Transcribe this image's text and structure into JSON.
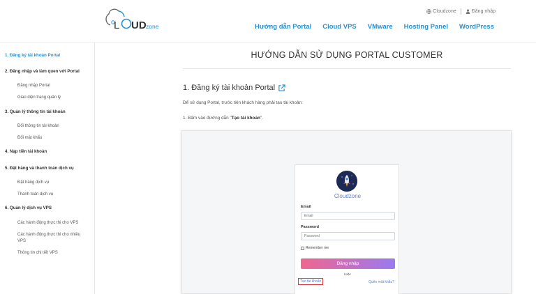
{
  "header": {
    "logo": {
      "prefix": "L",
      "brand_main": "UD",
      "brand_sub": "zone"
    },
    "top_links": [
      {
        "icon": "globe-icon",
        "label": "Cloudzone"
      },
      {
        "icon": "user-icon",
        "label": "Đăng nhập"
      }
    ],
    "nav": [
      "Hướng dẫn Portal",
      "Cloud VPS",
      "VMware",
      "Hosting Panel",
      "WordPress"
    ]
  },
  "sidebar": {
    "items": [
      {
        "label": "1. Đăng ký tài khoản Portal",
        "active": true,
        "subs": []
      },
      {
        "label": "2. Đăng nhập và làm quen với Portal",
        "subs": [
          "Đăng nhập Portal",
          "Giao diện trang quản lý"
        ]
      },
      {
        "label": "3. Quản lý thông tin tài khoản",
        "subs": [
          "Đổi thông tin tài khoản",
          "Đổi mật khẩu"
        ]
      },
      {
        "label": "4. Nạp tiền tài khoản",
        "subs": []
      },
      {
        "label": "5. Đặt hàng và thanh toán dịch vụ",
        "subs": [
          "Đặt hàng dịch vụ",
          "Thanh toán dịch vụ"
        ]
      },
      {
        "label": "6. Quản lý dịch vụ VPS",
        "subs": [
          "Các hành động thực thi cho VPS",
          "Các hành động thực thi cho nhiều VPS",
          "Thông tin chi tiết VPS"
        ]
      }
    ]
  },
  "main": {
    "title": "HƯỚNG DẪN SỬ DỤNG PORTAL CUSTOMER",
    "section_title": "1. Đăng ký tài khoản Portal",
    "para1": "Để sử dụng Portal, trước tiên khách hàng phải tạo tài khoản:",
    "para2_prefix": "1. Bấm vào đường dẫn \"",
    "para2_bold": "Tạo tài khoản",
    "para2_suffix": "\"."
  },
  "login_card": {
    "brand": "Cloudzone",
    "email_label": "Email",
    "email_placeholder": "Email",
    "password_label": "Password",
    "password_placeholder": "Password",
    "remember": "Remember me",
    "login_button": "Đăng nhập",
    "or": "hoặc",
    "register_link": "Tạo tài khoản",
    "forgot_link": "Quên mật khẩu?"
  },
  "colors": {
    "accent": "#2a8fd0",
    "link": "#5b7fd6",
    "highlight": "#e23b3b"
  }
}
